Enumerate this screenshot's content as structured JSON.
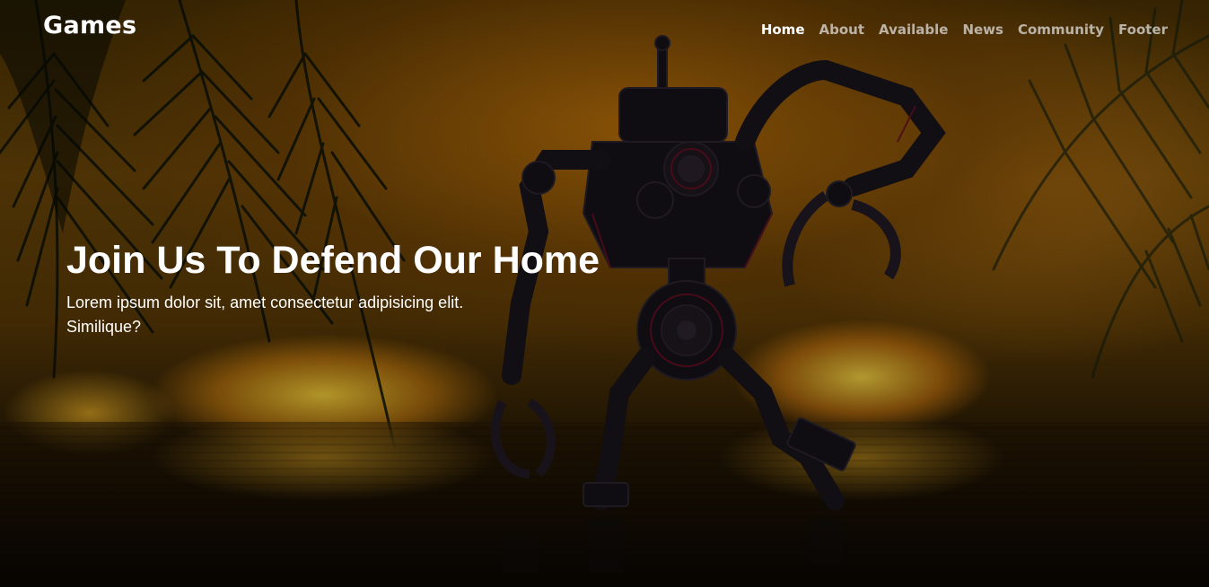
{
  "header": {
    "logo": "Games",
    "nav": [
      {
        "label": "Home",
        "active": true
      },
      {
        "label": "About",
        "active": false
      },
      {
        "label": "Available",
        "active": false
      },
      {
        "label": "News",
        "active": false
      },
      {
        "label": "Community",
        "active": false
      },
      {
        "label": "Footer",
        "active": false
      }
    ]
  },
  "hero": {
    "title": "Join Us To Defend Our Home",
    "description": "Lorem ipsum dolor sit, amet consectetur adipisicing elit. Similique?",
    "background_image": "robot-in-water-explosions",
    "colors": {
      "text": "#ffffff",
      "nav_inactive": "#c8c8c8",
      "background_glow": "#f5b41e"
    }
  }
}
